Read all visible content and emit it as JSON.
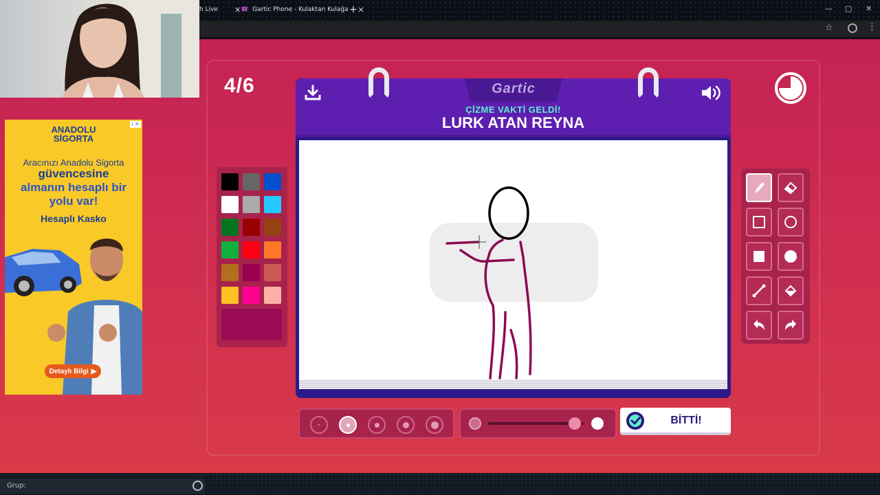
{
  "browser": {
    "tabs": [
      {
        "title": "h Live",
        "close": "✕"
      },
      {
        "title": "Gartic Phone - Kulaktan Kulağa",
        "close": "✕"
      }
    ],
    "new_tab": "+",
    "window_controls": [
      "—",
      "▢",
      "✕"
    ]
  },
  "ad": {
    "brand_line1": "ANADOLU",
    "brand_line2": "SİGORTA",
    "line1": "Aracınızı Anadolu Sigorta",
    "line2": "güvencesine",
    "line3": "almanın hesaplı bir yolu var!",
    "product": "Hesaplı Kasko",
    "cta": "Detaylı Bilgi",
    "info": "i ✕"
  },
  "game": {
    "round": "4/6",
    "brand": "Gartic",
    "prompt_label": "ÇİZME VAKTİ GELDİ!",
    "prompt": "LURK ATAN REYNA",
    "done_label": "BİTTİ!",
    "timer_progress": 0.75,
    "selected_color": "#9b0a55",
    "selected_brush_size_index": 1,
    "opacity": 0.9
  },
  "palette": {
    "colors": [
      "#000000",
      "#666666",
      "#0050cd",
      "#ffffff",
      "#aaaaaa",
      "#26c9ff",
      "#017420",
      "#990000",
      "#964112",
      "#11b03c",
      "#ff0013",
      "#ff7828",
      "#b0701c",
      "#99004e",
      "#cb5a57",
      "#ffc126",
      "#ff008f",
      "#feafa8"
    ]
  },
  "tools": [
    {
      "name": "pen",
      "active": true
    },
    {
      "name": "eraser",
      "active": false
    },
    {
      "name": "rectangle-outline",
      "active": false
    },
    {
      "name": "ellipse-outline",
      "active": false
    },
    {
      "name": "rectangle-filled",
      "active": false
    },
    {
      "name": "ellipse-filled",
      "active": false
    },
    {
      "name": "line",
      "active": false
    },
    {
      "name": "fill-bucket",
      "active": false
    },
    {
      "name": "undo",
      "active": false
    },
    {
      "name": "redo",
      "active": false
    }
  ],
  "chat": {
    "placeholder": "Grup:"
  }
}
